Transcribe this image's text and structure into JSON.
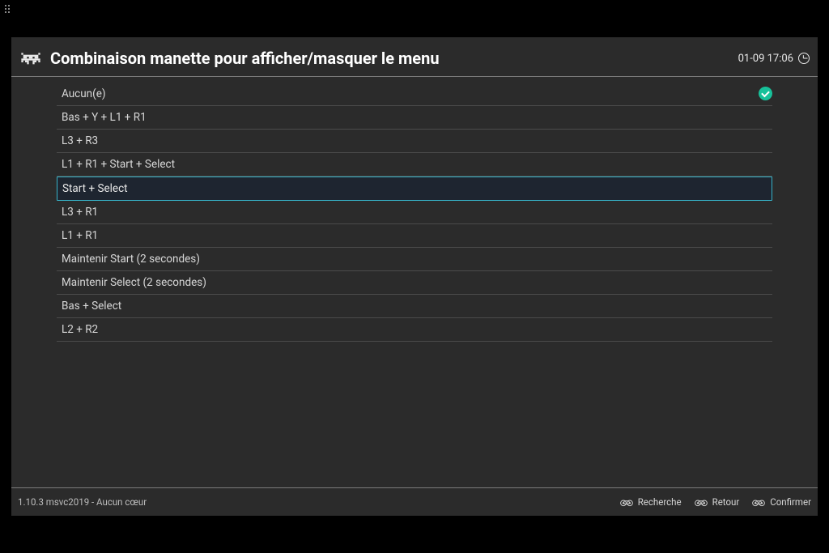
{
  "header": {
    "title": "Combinaison manette pour afficher/masquer le menu",
    "datetime": "01-09 17:06"
  },
  "options": [
    {
      "label": "Aucun(e)",
      "checked": true,
      "selected": false
    },
    {
      "label": "Bas + Y + L1 + R1",
      "checked": false,
      "selected": false
    },
    {
      "label": "L3 + R3",
      "checked": false,
      "selected": false
    },
    {
      "label": "L1 + R1 + Start + Select",
      "checked": false,
      "selected": false
    },
    {
      "label": "Start + Select",
      "checked": false,
      "selected": true
    },
    {
      "label": "L3 + R1",
      "checked": false,
      "selected": false
    },
    {
      "label": "L1 + R1",
      "checked": false,
      "selected": false
    },
    {
      "label": "Maintenir Start (2 secondes)",
      "checked": false,
      "selected": false
    },
    {
      "label": "Maintenir Select (2 secondes)",
      "checked": false,
      "selected": false
    },
    {
      "label": "Bas + Select",
      "checked": false,
      "selected": false
    },
    {
      "label": "L2 + R2",
      "checked": false,
      "selected": false
    }
  ],
  "footer": {
    "version": "1.10.3 msvc2019 - Aucun cœur",
    "search": "Recherche",
    "back": "Retour",
    "confirm": "Confirmer"
  }
}
